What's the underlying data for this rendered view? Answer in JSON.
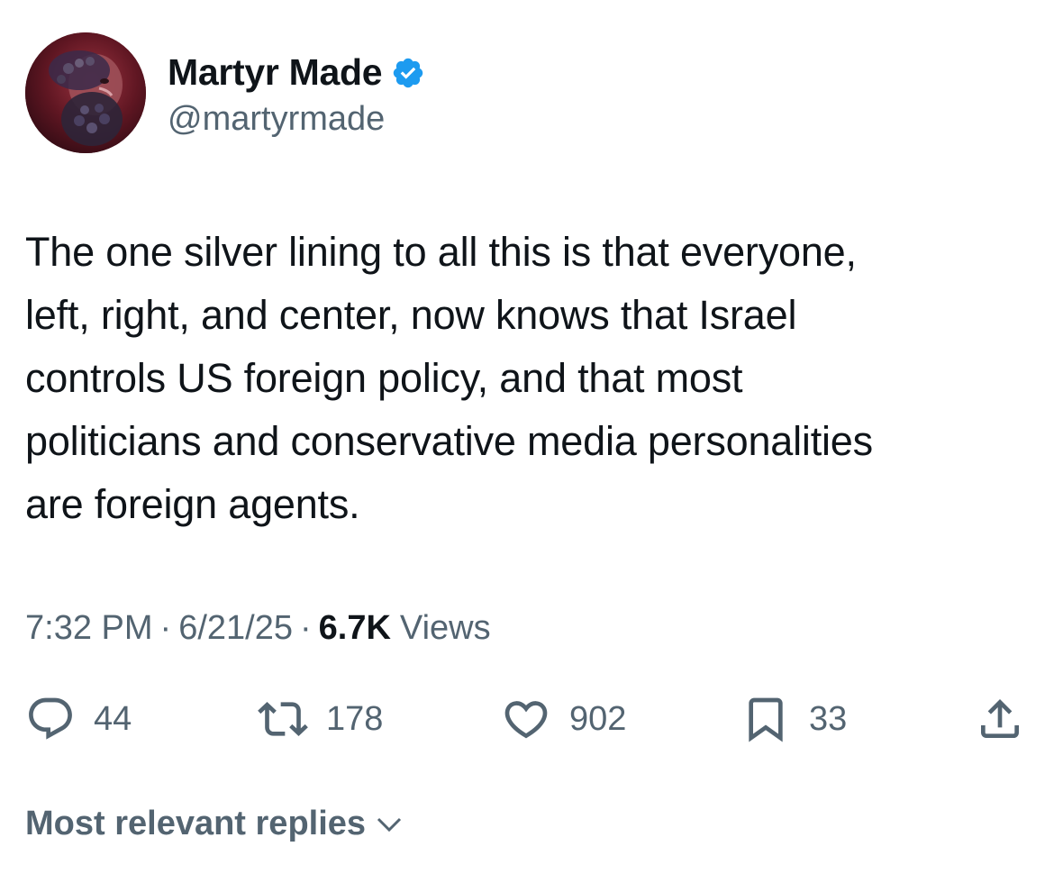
{
  "author": {
    "display_name": "Martyr Made",
    "handle": "@martyrmade",
    "verified": true,
    "avatar_icon": "bearded-statue-avatar"
  },
  "tweet": {
    "text": "The one silver lining to all this is that everyone,\nleft, right, and center, now knows that Israel\ncontrols US foreign policy, and that most\npoliticians and conservative media personalities\nare foreign agents.",
    "time": "7:32 PM",
    "separator": "·",
    "date": "6/21/25",
    "views_count": "6.7K",
    "views_label": "Views"
  },
  "actions": {
    "reply": {
      "icon": "reply-icon",
      "count": "44"
    },
    "repost": {
      "icon": "repost-icon",
      "count": "178"
    },
    "like": {
      "icon": "heart-icon",
      "count": "902"
    },
    "bookmark": {
      "icon": "bookmark-icon",
      "count": "33"
    },
    "share": {
      "icon": "share-icon"
    }
  },
  "replies": {
    "sort_label": "Most relevant replies",
    "icon": "chevron-down-icon"
  },
  "colors": {
    "primary_text": "#0f1419",
    "secondary_text": "#536471",
    "verified_blue": "#1d9bf0",
    "background": "#ffffff"
  }
}
